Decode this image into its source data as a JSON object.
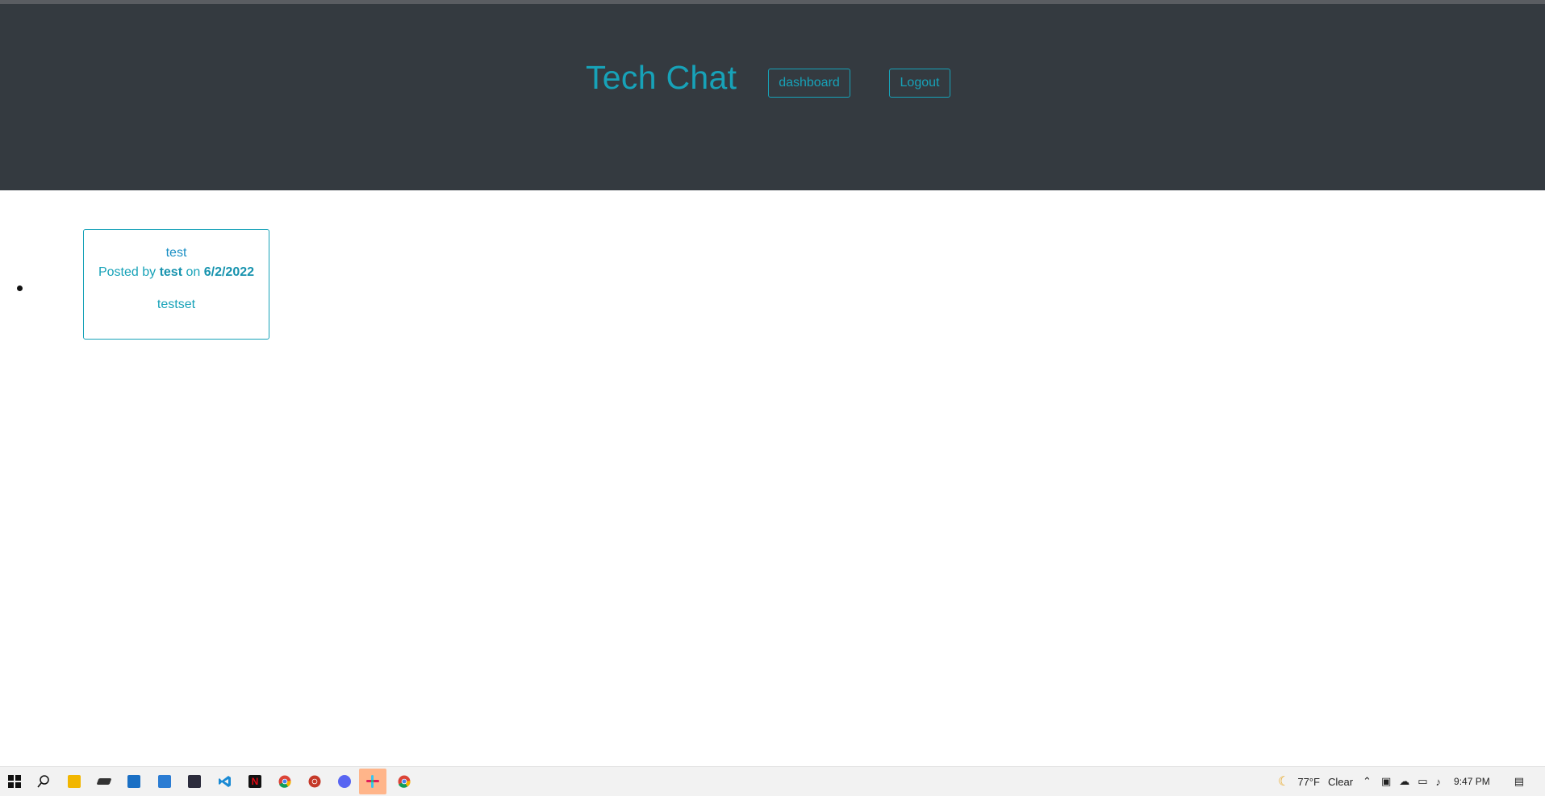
{
  "header": {
    "brand": "Tech Chat",
    "dashboard_label": "dashboard",
    "logout_label": "Logout"
  },
  "posts": [
    {
      "title": "test",
      "posted_by_prefix": "Posted by",
      "author": "test",
      "on_word": "on",
      "date": "6/2/2022",
      "body": "testset"
    }
  ],
  "taskbar": {
    "apps": [
      "windows-start",
      "search",
      "file-explorer",
      "app-dark",
      "app-store",
      "mail",
      "photo-app",
      "vscode",
      "netflix",
      "chrome",
      "chrome-red",
      "discord",
      "slack",
      "chrome-alt"
    ],
    "weather_temp": "77°F",
    "weather_text": "Clear",
    "time": "9:47 PM"
  },
  "colors": {
    "header_bg": "#343a40",
    "accent": "#17a2b8"
  }
}
